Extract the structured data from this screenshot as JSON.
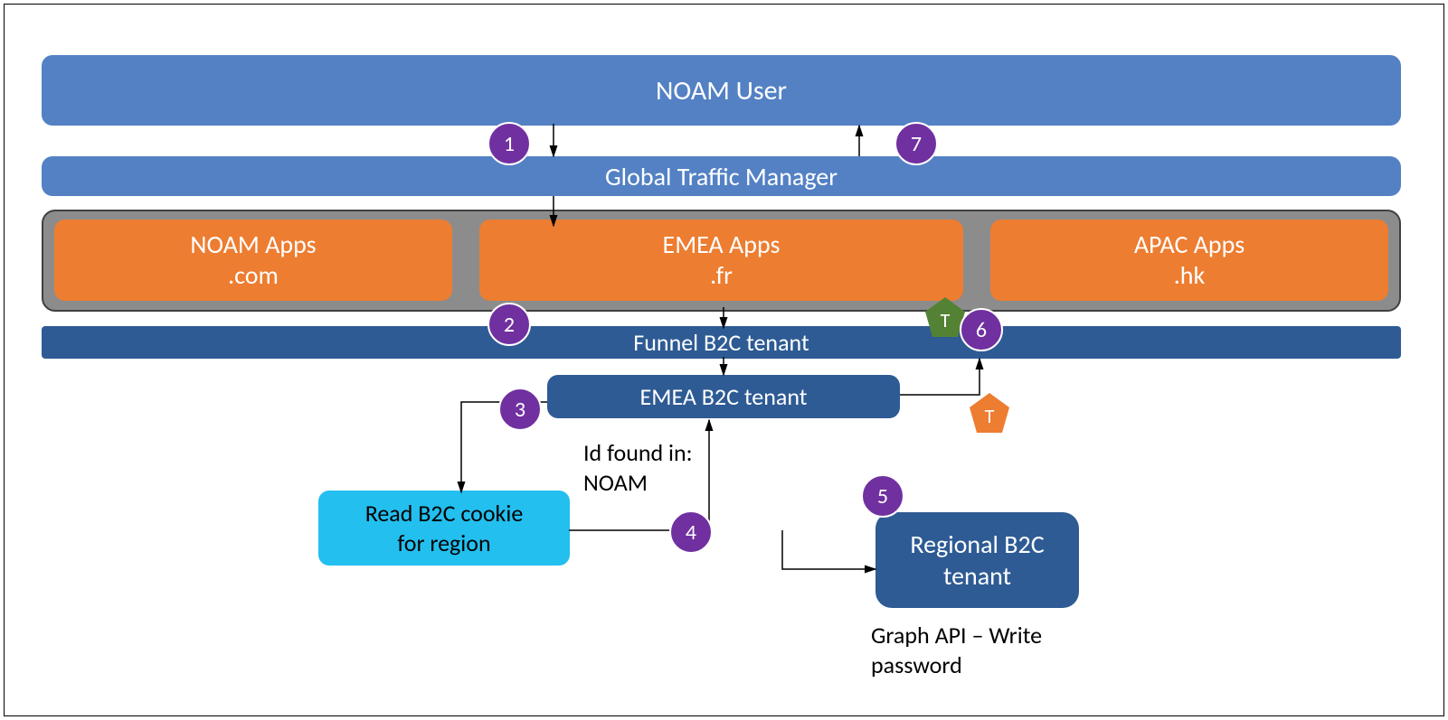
{
  "boxes": {
    "noam_user": "NOAM User",
    "gtm": "Global Traffic Manager",
    "noam_apps_l1": "NOAM Apps",
    "noam_apps_l2": ".com",
    "emea_apps_l1": "EMEA Apps",
    "emea_apps_l2": ".fr",
    "apac_apps_l1": "APAC Apps",
    "apac_apps_l2": ".hk",
    "funnel": "Funnel B2C tenant",
    "emea_tenant": "EMEA B2C tenant",
    "cookie_l1": "Read B2C cookie",
    "cookie_l2": "for region",
    "regional_l1": "Regional B2C",
    "regional_l2": "tenant"
  },
  "notes": {
    "id_found_l1": "Id found in:",
    "id_found_l2": "NOAM",
    "graph_l1": "Graph API – Write",
    "graph_l2": "password"
  },
  "steps": {
    "s1": "1",
    "s2": "2",
    "s3": "3",
    "s4": "4",
    "s5": "5",
    "s6": "6",
    "s7": "7"
  },
  "tokens": {
    "green": "T",
    "orange": "T"
  },
  "colors": {
    "blue": "#5381c4",
    "dark": "#2e5b94",
    "orange": "#ed7d31",
    "cyan": "#22bfef",
    "purple": "#7030a0",
    "green": "#548235",
    "gray": "#8c8c8c"
  }
}
